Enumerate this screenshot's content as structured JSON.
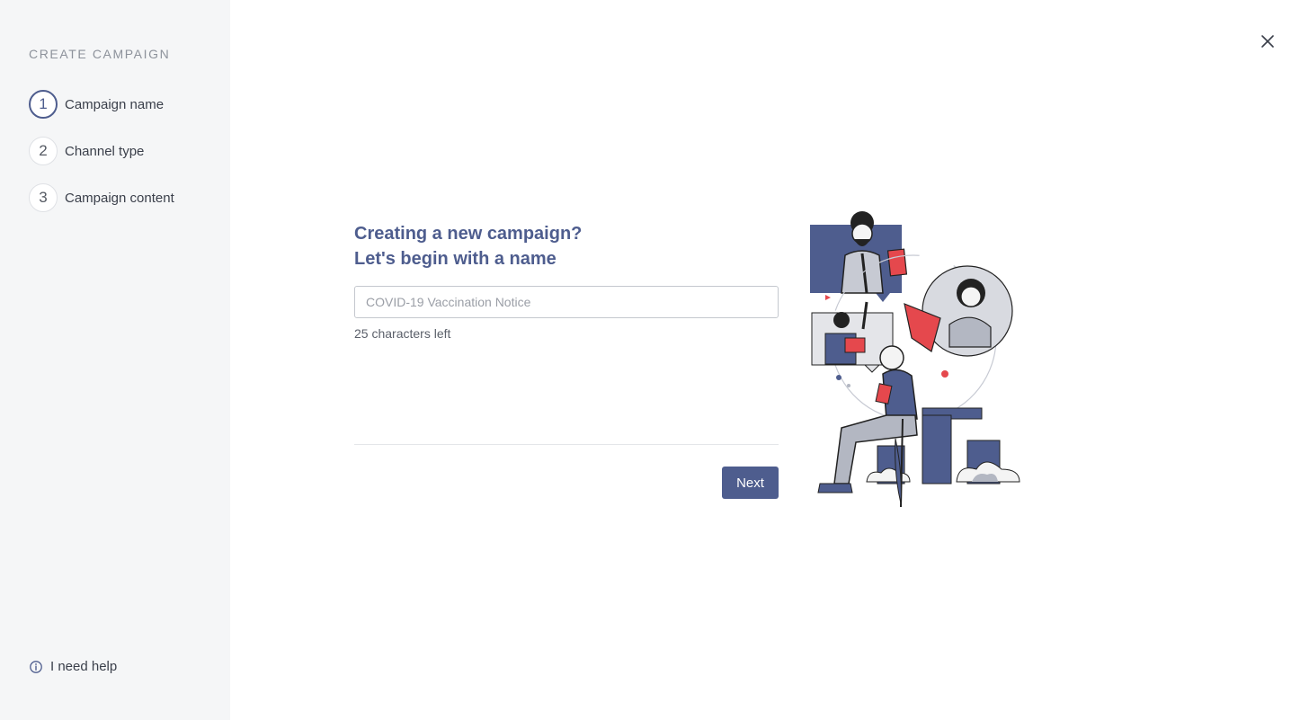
{
  "sidebar": {
    "title": "CREATE CAMPAIGN",
    "steps": [
      {
        "number": "1",
        "label": "Campaign name",
        "active": true
      },
      {
        "number": "2",
        "label": "Channel type",
        "active": false
      },
      {
        "number": "3",
        "label": "Campaign content",
        "active": false
      }
    ],
    "help_label": "I need help"
  },
  "form": {
    "heading_line1": "Creating a new campaign?",
    "heading_line2": "Let's begin with a name",
    "name_placeholder": "COVID-19 Vaccination Notice",
    "name_value": "",
    "char_count": "25 characters left",
    "next_label": "Next"
  },
  "colors": {
    "accent": "#4e5d8e",
    "sidebar_bg": "#f5f6f7",
    "illustration_red": "#e5484d"
  },
  "icons": {
    "close": "close-icon",
    "help": "info-circle-icon"
  }
}
